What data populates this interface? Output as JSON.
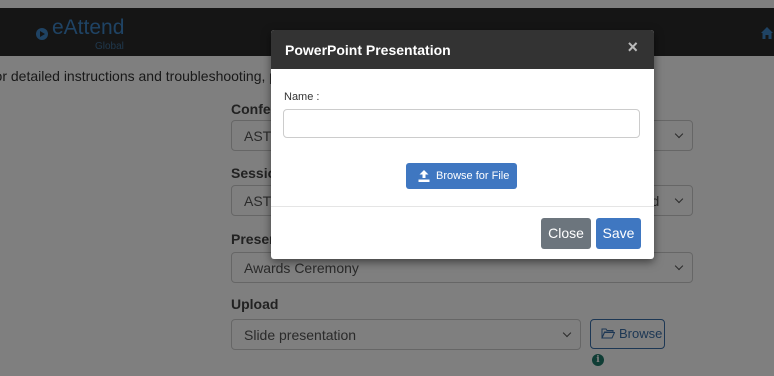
{
  "navbar": {
    "logo_name": "eAttend",
    "logo_sub": "Global",
    "home_icon": "home-icon"
  },
  "page": {
    "instructions": "For detailed instructions and troubleshooting, please",
    "fields": {
      "conference": {
        "label": "Conference",
        "value": "ASTM"
      },
      "session": {
        "label": "Session",
        "value": "ASTM",
        "value_tail": "ard"
      },
      "presentation": {
        "label": "Presentation",
        "value": "Awards Ceremony"
      },
      "upload": {
        "label": "Upload",
        "value": "Slide presentation"
      }
    },
    "browse_label": "Browse",
    "info_icon": "info-icon"
  },
  "modal": {
    "title": "PowerPoint Presentation",
    "close_glyph": "×",
    "name_label": "Name :",
    "name_value": "",
    "browse_file_label": "Browse for File",
    "close_label": "Close",
    "save_label": "Save"
  },
  "colors": {
    "navbar_bg": "#2b2b2b",
    "brand_blue": "#3f86c8",
    "primary": "#3f77c1",
    "secondary": "#6c757d",
    "info": "#1f7a6b"
  }
}
